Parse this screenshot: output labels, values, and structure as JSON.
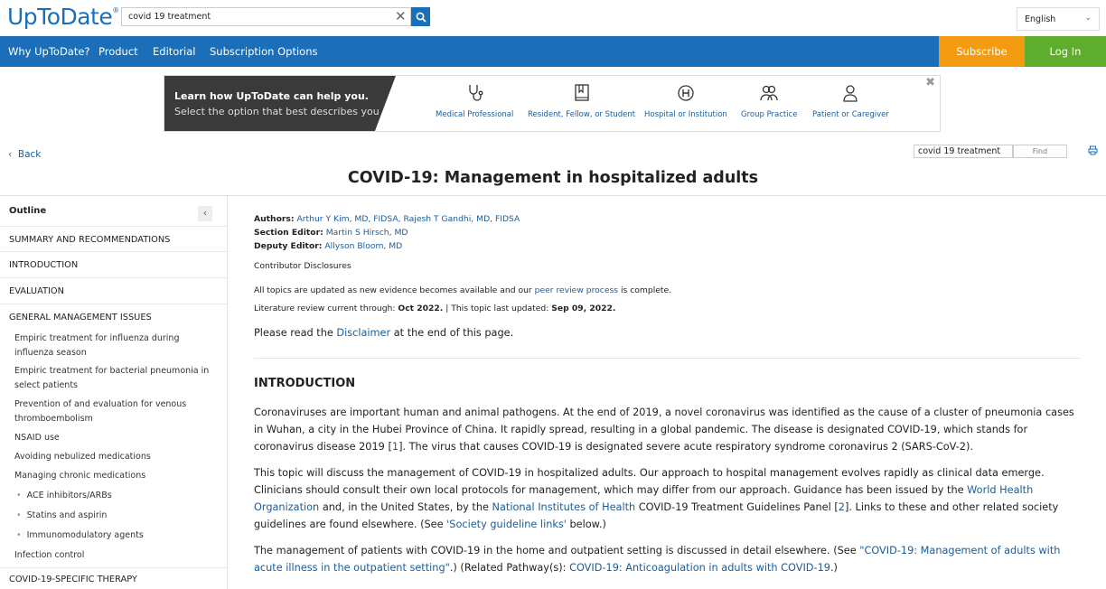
{
  "header": {
    "logo": "UpToDate",
    "logo_mark": "®",
    "search_value": "covid 19 treatment",
    "language": "English"
  },
  "nav": {
    "items": [
      "Why UpToDate?",
      "Product",
      "Editorial",
      "Subscription Options"
    ],
    "subscribe": "Subscribe",
    "login": "Log In"
  },
  "banner": {
    "title": "Learn how UpToDate can help you.",
    "subtitle": "Select the option that best describes you",
    "options": [
      "Medical Professional",
      "Resident, Fellow, or Student",
      "Hospital or Institution",
      "Group Practice",
      "Patient or Caregiver"
    ]
  },
  "toolbar": {
    "back": "Back",
    "find_value": "covid 19 treatment",
    "find_button": "Find"
  },
  "title": "COVID-19: Management in hospitalized adults",
  "outline": {
    "heading": "Outline",
    "sections": [
      "SUMMARY AND RECOMMENDATIONS",
      "INTRODUCTION",
      "EVALUATION",
      "GENERAL MANAGEMENT ISSUES"
    ],
    "subsections": [
      "Empiric treatment for influenza during influenza season",
      "Empiric treatment for bacterial pneumonia in select patients",
      "Prevention of and evaluation for venous thromboembolism",
      "NSAID use",
      "Avoiding nebulized medications",
      "Managing chronic medications"
    ],
    "subsubsections": [
      "ACE inhibitors/ARBs",
      "Statins and aspirin",
      "Immunomodulatory agents"
    ],
    "after": "Infection control",
    "last_section": "COVID-19-SPECIFIC THERAPY"
  },
  "article": {
    "authors_label": "Authors:",
    "authors": "Arthur Y Kim, MD, FIDSA, Rajesh T Gandhi, MD, FIDSA",
    "section_editor_label": "Section Editor:",
    "section_editor": "Martin S Hirsch, MD",
    "deputy_editor_label": "Deputy Editor:",
    "deputy_editor": "Allyson Bloom, MD",
    "disclosures": "Contributor Disclosures",
    "update_pre": "All topics are updated as new evidence becomes available and our ",
    "update_link": "peer review process",
    "update_post": " is complete.",
    "lit_label": "Literature review current through: ",
    "lit_date": "Oct 2022.",
    "updated_label": " | This topic last updated: ",
    "updated_date": "Sep 09, 2022.",
    "disclaimer_pre": "Please read the ",
    "disclaimer_link": "Disclaimer",
    "disclaimer_post": " at the end of this page.",
    "intro_heading": "INTRODUCTION",
    "p1": "Coronaviruses are important human and animal pathogens. At the end of 2019, a novel coronavirus was identified as the cause of a cluster of pneumonia cases in Wuhan, a city in the Hubei Province of China. It rapidly spread, resulting in a global pandemic. The disease is designated COVID-19, which stands for coronavirus disease 2019 [",
    "p1_ref": "1",
    "p1_end": "]. The virus that causes COVID-19 is designated severe acute respiratory syndrome coronavirus 2 (SARS-CoV-2).",
    "p2_a": "This topic will discuss the management of COVID-19 in hospitalized adults. Our approach to hospital management evolves rapidly as clinical data emerge. Clinicians should consult their own local protocols for management, which may differ from our approach. Guidance has been issued by the ",
    "p2_who": "World Health Organization",
    "p2_b": " and, in the United States, by the ",
    "p2_nih": "National Institutes of Health",
    "p2_c": " COVID-19 Treatment Guidelines Panel [",
    "p2_ref": "2",
    "p2_d": "]. Links to these and other related society guidelines are found elsewhere. (See ",
    "p2_link": "'Society guideline links'",
    "p2_e": " below.)",
    "p3_a": "The management of patients with COVID-19 in the home and outpatient setting is discussed in detail elsewhere. (See ",
    "p3_link": "\"COVID-19: Management of adults with acute illness in the outpatient setting\"",
    "p3_b": ".) (Related Pathway(s): ",
    "p3_path": "COVID-19: Anticoagulation in adults with COVID-19",
    "p3_c": ".)"
  },
  "colors": {
    "brand_blue": "#1a6fb8",
    "subscribe_orange": "#f39c12",
    "login_green": "#5fad2e",
    "link": "#1a5c9a"
  }
}
